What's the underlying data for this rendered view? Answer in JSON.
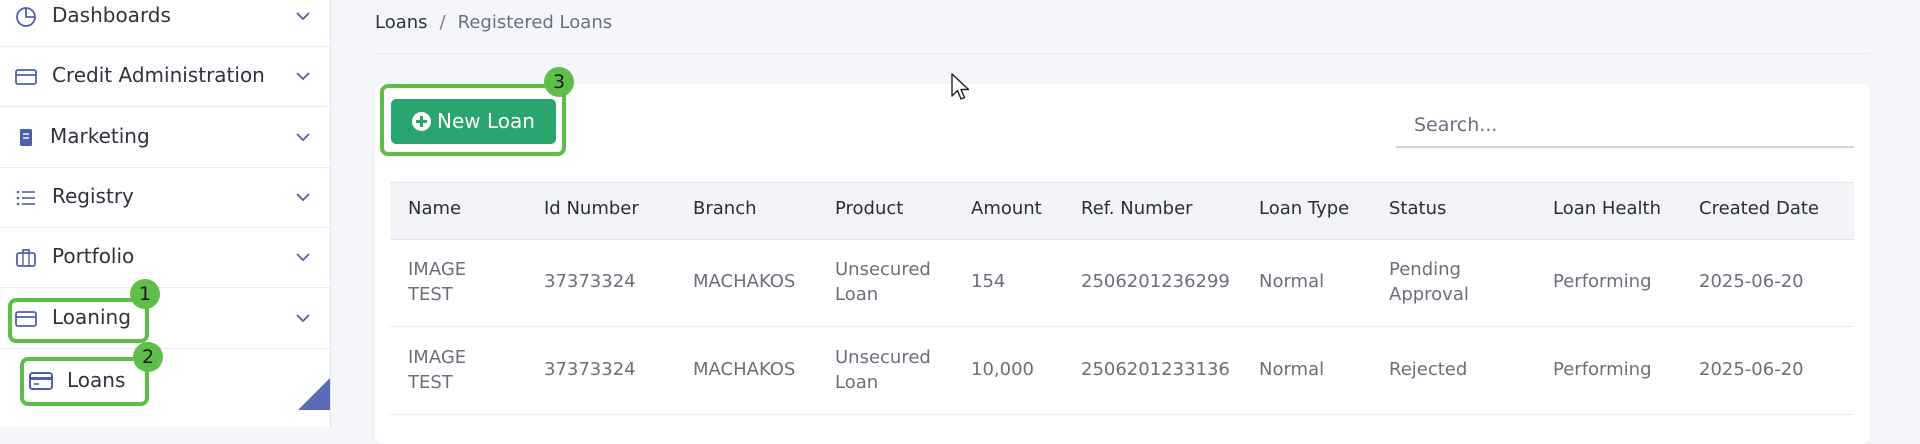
{
  "sidebar": {
    "items": [
      {
        "label": "Dashboards",
        "icon": "pie-chart-icon"
      },
      {
        "label": "Credit Administration",
        "icon": "credit-card-icon"
      },
      {
        "label": "Marketing",
        "icon": "document-icon"
      },
      {
        "label": "Registry",
        "icon": "list-icon"
      },
      {
        "label": "Portfolio",
        "icon": "briefcase-icon"
      },
      {
        "label": "Loaning",
        "icon": "credit-card-icon"
      }
    ],
    "sub_items": [
      {
        "label": "Loans",
        "icon": "card-icon"
      }
    ]
  },
  "annotations": [
    "1",
    "2",
    "3"
  ],
  "breadcrumb": {
    "root": "Loans",
    "separator": "/",
    "current": "Registered Loans"
  },
  "toolbar": {
    "new_loan_label": "New Loan",
    "search_placeholder": "Search..."
  },
  "table": {
    "headers": [
      "Name",
      "Id Number",
      "Branch",
      "Product",
      "Amount",
      "Ref. Number",
      "Loan Type",
      "Status",
      "Loan Health",
      "Created Date"
    ],
    "rows": [
      {
        "name": [
          "IMAGE",
          "TEST"
        ],
        "id_number": "37373324",
        "branch": "MACHAKOS",
        "product": [
          "Unsecured",
          "Loan"
        ],
        "amount": "154",
        "ref_number": "2506201236299",
        "loan_type": "Normal",
        "status": [
          "Pending",
          "Approval"
        ],
        "loan_health": "Performing",
        "created_date": "2025-06-20"
      },
      {
        "name": [
          "IMAGE",
          "TEST"
        ],
        "id_number": "37373324",
        "branch": "MACHAKOS",
        "product": [
          "Unsecured",
          "Loan"
        ],
        "amount": "10,000",
        "ref_number": "2506201233136",
        "loan_type": "Normal",
        "status": [
          "Rejected"
        ],
        "loan_health": "Performing",
        "created_date": "2025-06-20"
      }
    ]
  },
  "colors": {
    "accent_green": "#2aa56f",
    "highlight_green": "#5fbe4a",
    "icon_blue": "#4f5fb0"
  }
}
